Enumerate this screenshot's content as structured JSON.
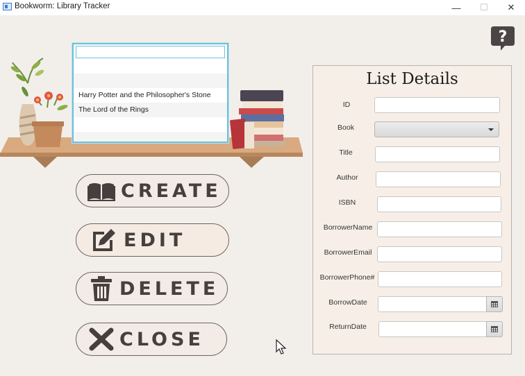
{
  "window": {
    "title": "Bookworm: Library Tracker",
    "controls": {
      "minimize": "—",
      "maximize": "☐",
      "close": "✕"
    }
  },
  "help": {
    "icon": "question-bubble-icon",
    "glyph": "?"
  },
  "list": {
    "search_value": "",
    "items": [
      "",
      "",
      "Harry Potter and the Philosopher's Stone",
      "The Lord of the Rings",
      "",
      ""
    ]
  },
  "actions": [
    {
      "key": "create",
      "label": "CREATE",
      "icon": "open-book-icon"
    },
    {
      "key": "edit",
      "label": "EDIT",
      "icon": "edit-pencil-icon"
    },
    {
      "key": "delete",
      "label": "DELETE",
      "icon": "trash-icon"
    },
    {
      "key": "close",
      "label": "CLOSE",
      "icon": "x-icon"
    }
  ],
  "details": {
    "title": "List Details",
    "fields": [
      {
        "label": "ID",
        "type": "text",
        "value": ""
      },
      {
        "label": "Book",
        "type": "combo",
        "value": ""
      },
      {
        "label": "Title",
        "type": "text",
        "value": ""
      },
      {
        "label": "Author",
        "type": "text",
        "value": ""
      },
      {
        "label": "ISBN",
        "type": "text",
        "value": ""
      },
      {
        "label": "BorrowerName",
        "type": "text",
        "value": ""
      },
      {
        "label": "BorrowerEmail",
        "type": "text",
        "value": ""
      },
      {
        "label": "BorrowerPhone#",
        "type": "text",
        "value": ""
      },
      {
        "label": "BorrowDate",
        "type": "date",
        "value": ""
      },
      {
        "label": "ReturnDate",
        "type": "date",
        "value": ""
      }
    ]
  },
  "colors": {
    "background": "#f2efeb",
    "shelf": "#d4a57a",
    "list_border": "#6cc0d8",
    "button_text": "#45403e",
    "panel_bg": "#f7efe7"
  }
}
